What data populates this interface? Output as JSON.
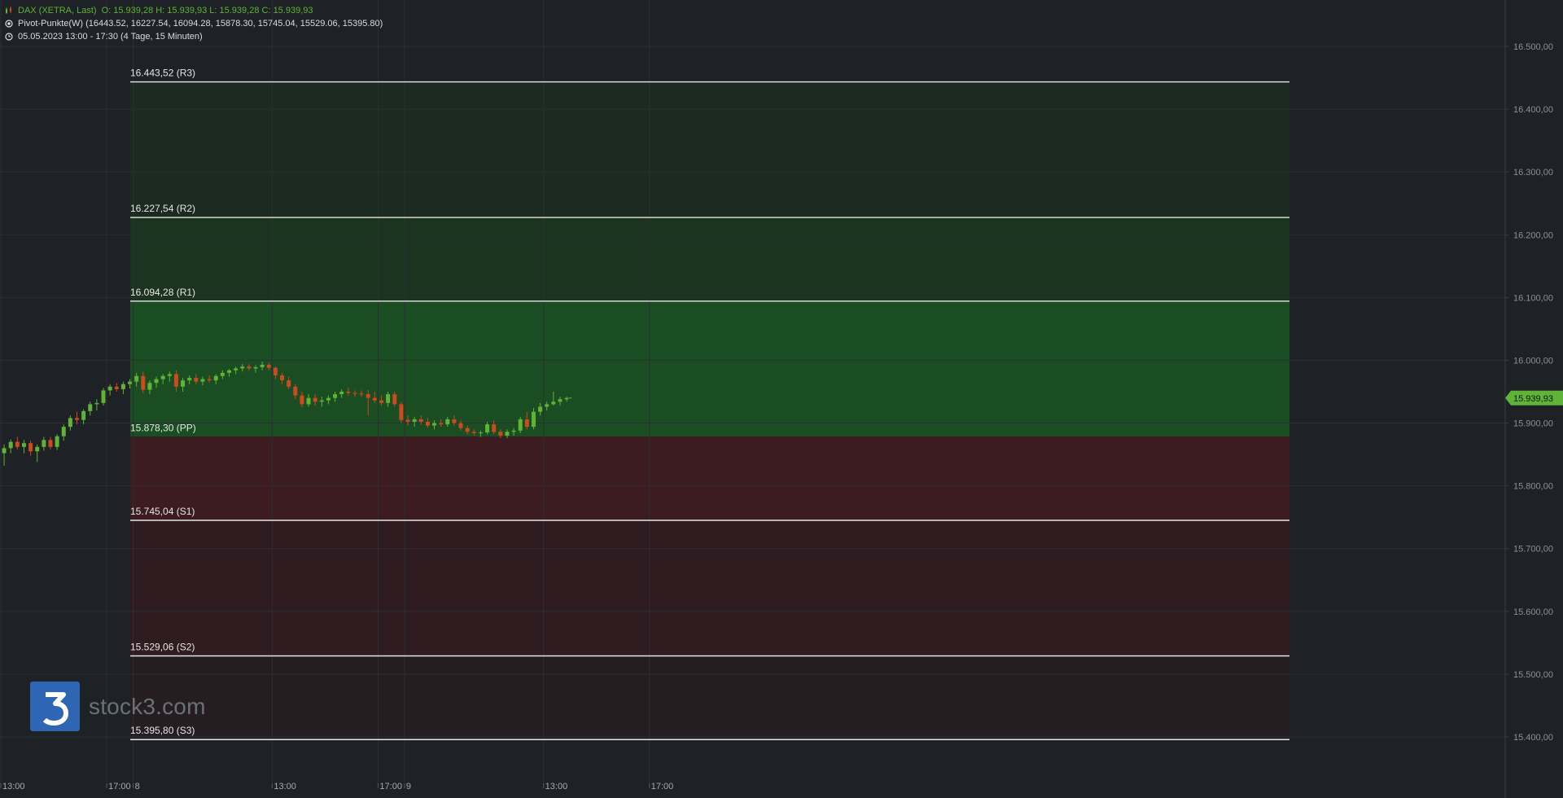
{
  "header": {
    "instrument": "DAX (XETRA, Last)",
    "ohlc": "O: 15.939,28  H: 15.939,93  L: 15.939,28  C: 15.939,93",
    "indicator": "Pivot-Punkte(W)  (16443.52,  16227.54,  16094.28,  15878.30,  15745.04,  15529.06,  15395.80)",
    "period": "05.05.2023 13:00 - 17:30   (4 Tage, 15 Minuten)"
  },
  "icons": {
    "instrument": "candlestick-icon",
    "indicator": "target-icon",
    "period": "clock-icon"
  },
  "logo": {
    "text": "stock3.com",
    "mark": "3"
  },
  "colors": {
    "background": "#1e2126",
    "up": "#5fb336",
    "down": "#cc4a1f",
    "resistance_zone": "#1a4d22",
    "support_zone": "#4a1c20",
    "pivot_line": "#e6e6e6",
    "price_tag": "#5fb336"
  },
  "chart_data": {
    "type": "candlestick",
    "interval": "15 Minuten",
    "y_range": [
      15300,
      16570
    ],
    "y_ticks": [
      15400,
      15500,
      15600,
      15700,
      15800,
      15900,
      16000,
      16100,
      16200,
      16300,
      16400,
      16500
    ],
    "y_tick_labels": [
      "15.400,00",
      "15.500,00",
      "15.600,00",
      "15.700,00",
      "15.800,00",
      "15.900,00",
      "16.000,00",
      "16.100,00",
      "16.200,00",
      "16.300,00",
      "16.400,00",
      "16.500,00"
    ],
    "x_tick_labels": [
      {
        "label": "13:00",
        "bar": 0
      },
      {
        "label": "17:00",
        "bar": 16
      },
      {
        "label": "8",
        "bar": 20
      },
      {
        "label": "13:00",
        "bar": 41
      },
      {
        "label": "17:00",
        "bar": 57
      },
      {
        "label": "9",
        "bar": 61
      },
      {
        "label": "13:00",
        "bar": 82
      },
      {
        "label": "17:00",
        "bar": 98
      }
    ],
    "last_price": 15939.93,
    "last_price_label": "15.939,93",
    "pivot_levels": [
      {
        "label": "16.443,52 (R3)",
        "value": 16443.52,
        "zone": "resistance"
      },
      {
        "label": "16.227,54 (R2)",
        "value": 16227.54,
        "zone": "resistance"
      },
      {
        "label": "16.094,28 (R1)",
        "value": 16094.28,
        "zone": "resistance"
      },
      {
        "label": "15.878,30 (PP)",
        "value": 15878.3,
        "zone": "pivot"
      },
      {
        "label": "15.745,04 (S1)",
        "value": 15745.04,
        "zone": "support"
      },
      {
        "label": "15.529,06 (S2)",
        "value": 15529.06,
        "zone": "support"
      },
      {
        "label": "15.395,80 (S3)",
        "value": 15395.8,
        "zone": "support"
      }
    ],
    "candles": [
      [
        15852,
        15866,
        15832,
        15860
      ],
      [
        15860,
        15874,
        15852,
        15870
      ],
      [
        15870,
        15878,
        15858,
        15862
      ],
      [
        15862,
        15873,
        15852,
        15868
      ],
      [
        15868,
        15872,
        15848,
        15855
      ],
      [
        15855,
        15866,
        15838,
        15862
      ],
      [
        15862,
        15878,
        15856,
        15873
      ],
      [
        15873,
        15878,
        15858,
        15862
      ],
      [
        15862,
        15882,
        15857,
        15879
      ],
      [
        15879,
        15898,
        15872,
        15894
      ],
      [
        15894,
        15912,
        15888,
        15908
      ],
      [
        15908,
        15918,
        15898,
        15905
      ],
      [
        15905,
        15922,
        15898,
        15919
      ],
      [
        15919,
        15934,
        15912,
        15930
      ],
      [
        15930,
        15938,
        15920,
        15932
      ],
      [
        15932,
        15956,
        15928,
        15952
      ],
      [
        15952,
        15962,
        15944,
        15958
      ],
      [
        15958,
        15964,
        15950,
        15954
      ],
      [
        15954,
        15966,
        15946,
        15962
      ],
      [
        15962,
        15970,
        15955,
        15966
      ],
      [
        15966,
        15980,
        15958,
        15975
      ],
      [
        15975,
        15982,
        15948,
        15953
      ],
      [
        15953,
        15968,
        15946,
        15964
      ],
      [
        15964,
        15974,
        15956,
        15970
      ],
      [
        15970,
        15978,
        15962,
        15975
      ],
      [
        15975,
        15982,
        15966,
        15978
      ],
      [
        15978,
        15984,
        15950,
        15958
      ],
      [
        15958,
        15972,
        15950,
        15968
      ],
      [
        15968,
        15976,
        15962,
        15972
      ],
      [
        15972,
        15978,
        15962,
        15966
      ],
      [
        15966,
        15974,
        15960,
        15970
      ],
      [
        15970,
        15976,
        15964,
        15968
      ],
      [
        15968,
        15978,
        15962,
        15975
      ],
      [
        15975,
        15984,
        15970,
        15980
      ],
      [
        15980,
        15986,
        15974,
        15984
      ],
      [
        15984,
        15990,
        15978,
        15987
      ],
      [
        15987,
        15994,
        15982,
        15990
      ],
      [
        15990,
        15994,
        15984,
        15987
      ],
      [
        15987,
        15992,
        15980,
        15989
      ],
      [
        15989,
        15998,
        15984,
        15993
      ],
      [
        15993,
        15996,
        15984,
        15988
      ],
      [
        15988,
        15990,
        15970,
        15976
      ],
      [
        15976,
        15980,
        15962,
        15968
      ],
      [
        15968,
        15974,
        15954,
        15958
      ],
      [
        15958,
        15962,
        15938,
        15944
      ],
      [
        15944,
        15950,
        15925,
        15930
      ],
      [
        15930,
        15946,
        15926,
        15940
      ],
      [
        15940,
        15946,
        15928,
        15934
      ],
      [
        15934,
        15942,
        15926,
        15936
      ],
      [
        15936,
        15944,
        15930,
        15940
      ],
      [
        15940,
        15950,
        15934,
        15946
      ],
      [
        15946,
        15954,
        15940,
        15950
      ],
      [
        15950,
        15956,
        15944,
        15948
      ],
      [
        15948,
        15952,
        15942,
        15947
      ],
      [
        15947,
        15952,
        15942,
        15946
      ],
      [
        15946,
        15953,
        15912,
        15940
      ],
      [
        15940,
        15950,
        15932,
        15936
      ],
      [
        15936,
        15944,
        15928,
        15932
      ],
      [
        15932,
        15950,
        15926,
        15946
      ],
      [
        15946,
        15950,
        15926,
        15930
      ],
      [
        15930,
        15934,
        15900,
        15905
      ],
      [
        15905,
        15912,
        15896,
        15902
      ],
      [
        15902,
        15910,
        15894,
        15906
      ],
      [
        15906,
        15912,
        15898,
        15902
      ],
      [
        15902,
        15908,
        15892,
        15896
      ],
      [
        15896,
        15904,
        15890,
        15900
      ],
      [
        15900,
        15906,
        15894,
        15898
      ],
      [
        15898,
        15910,
        15894,
        15906
      ],
      [
        15906,
        15912,
        15896,
        15900
      ],
      [
        15900,
        15904,
        15888,
        15892
      ],
      [
        15892,
        15896,
        15882,
        15886
      ],
      [
        15886,
        15890,
        15880,
        15884
      ],
      [
        15884,
        15888,
        15878,
        15885
      ],
      [
        15885,
        15902,
        15882,
        15898
      ],
      [
        15898,
        15904,
        15882,
        15886
      ],
      [
        15886,
        15890,
        15876,
        15880
      ],
      [
        15880,
        15890,
        15876,
        15886
      ],
      [
        15886,
        15892,
        15880,
        15888
      ],
      [
        15888,
        15910,
        15884,
        15906
      ],
      [
        15906,
        15918,
        15890,
        15894
      ],
      [
        15894,
        15924,
        15890,
        15918
      ],
      [
        15918,
        15932,
        15912,
        15926
      ],
      [
        15926,
        15934,
        15920,
        15930
      ],
      [
        15930,
        15950,
        15928,
        15934
      ],
      [
        15934,
        15942,
        15928,
        15938
      ],
      [
        15938,
        15942,
        15934,
        15939.93
      ]
    ]
  }
}
